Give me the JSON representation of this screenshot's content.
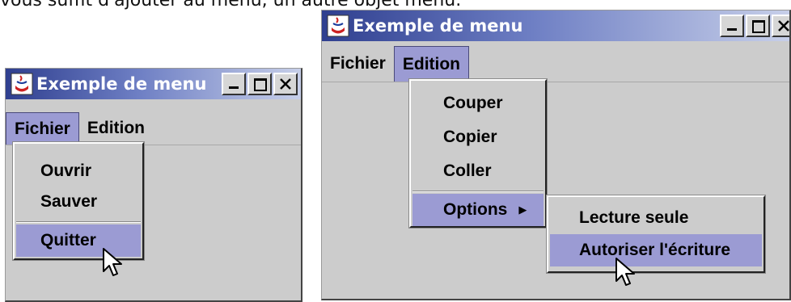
{
  "caption": "vous suffit d'ajouter au menu, un autre objet menu.",
  "colors": {
    "menu_highlight": "#9b9bd3",
    "window_bg": "#cccccc",
    "title_gradient_start": "#2f3f8f"
  },
  "window_left": {
    "title": "Exemple de menu",
    "menubar": [
      "Fichier",
      "Edition"
    ],
    "active_menu": "Fichier",
    "popup_items": [
      "Ouvrir",
      "Sauver",
      "Quitter"
    ],
    "selected_item": "Quitter"
  },
  "window_right": {
    "title": "Exemple de menu",
    "menubar": [
      "Fichier",
      "Edition"
    ],
    "active_menu": "Edition",
    "popup_items": [
      "Couper",
      "Copier",
      "Coller",
      "Options"
    ],
    "submenu_arrow": "▶",
    "submenu_items": [
      "Lecture seule",
      "Autoriser l'écriture"
    ],
    "selected_item": "Options",
    "selected_subitem": "Autoriser l'écriture"
  },
  "icons": [
    "java-app-icon",
    "minimize-icon",
    "maximize-icon",
    "close-icon",
    "mouse-cursor-icon",
    "submenu-arrow-icon"
  ]
}
